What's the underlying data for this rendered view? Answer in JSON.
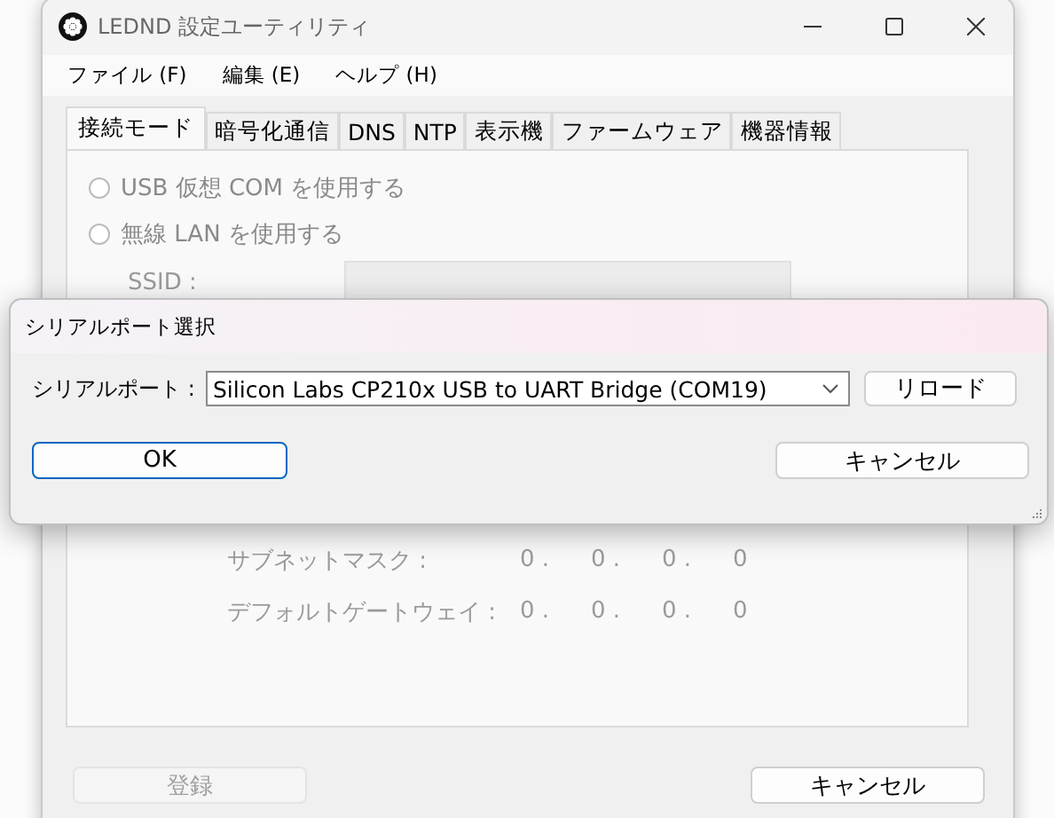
{
  "main_window": {
    "title": "LEDND 設定ユーティリティ",
    "menu": [
      "ファイル (F)",
      "編集 (E)",
      "ヘルプ (H)"
    ],
    "tabs": [
      {
        "label": "接続モード",
        "selected": true
      },
      {
        "label": "暗号化通信",
        "selected": false
      },
      {
        "label": "DNS",
        "selected": false
      },
      {
        "label": "NTP",
        "selected": false
      },
      {
        "label": "表示機",
        "selected": false
      },
      {
        "label": "ファームウェア",
        "selected": false
      },
      {
        "label": "機器情報",
        "selected": false
      }
    ],
    "connection": [
      {
        "label": "USB 仮想 COM を使用する",
        "selected": false,
        "disabled": true
      },
      {
        "label": "無線 LAN を使用する",
        "selected": false,
        "disabled": true
      }
    ],
    "ssid_label": "SSID :",
    "ip_rows": [
      {
        "label": "サブネットマスク :",
        "octets": [
          "0 .",
          "0 .",
          "0 .",
          "0"
        ]
      },
      {
        "label": "デフォルトゲートウェイ :",
        "octets": [
          "0 .",
          "0 .",
          "0 .",
          "0"
        ]
      }
    ],
    "buttons": [
      {
        "label": "登録",
        "disabled": true
      },
      {
        "label": "キャンセル",
        "disabled": false
      }
    ]
  },
  "dialog": {
    "title": "シリアルポート選択",
    "port_label": "シリアルポート :",
    "port_value": "Silicon Labs CP210x USB to UART Bridge (COM19)",
    "reload": "リロード",
    "ok": "OK",
    "cancel": "キャンセル"
  }
}
